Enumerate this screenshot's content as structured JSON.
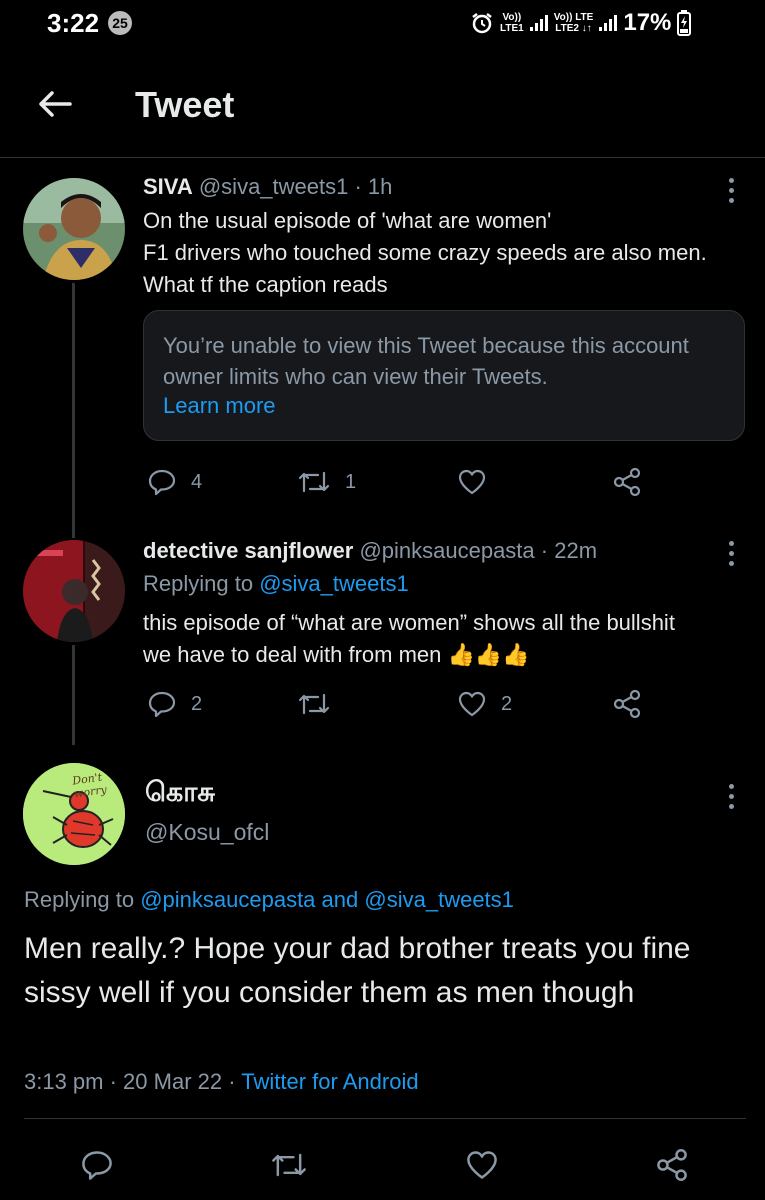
{
  "status_bar": {
    "time": "3:22",
    "notification_count": "25",
    "sim1": {
      "top": "Vo))",
      "bottom": "LTE1"
    },
    "sim2": {
      "top": "Vo)) LTE",
      "bottom": "LTE2 ↓↑"
    },
    "battery": "17%"
  },
  "header": {
    "title": "Tweet"
  },
  "tweet1": {
    "name": "SIVA",
    "handle": "@siva_tweets1",
    "time": "· 1h",
    "text": "On the usual episode of 'what are women'\nF1 drivers who touched some crazy speeds are also men.\nWhat tf the caption reads",
    "quoted_unavailable": "You’re unable to view this Tweet because this account owner limits who can view their Tweets.",
    "quoted_link": "Learn more",
    "replies": "4",
    "retweets": "1",
    "likes": ""
  },
  "tweet2": {
    "name": "detective sanjflower",
    "handle": "@pinksaucepasta",
    "time": "· 22m",
    "replying_prefix": "Replying to",
    "replying_to": "@siva_tweets1",
    "text": "this episode of “what are women” shows all the bullshit\nwe have to deal with from men",
    "emoji": "👍👍👍",
    "replies": "2",
    "retweets": "",
    "likes": "2"
  },
  "main_tweet": {
    "name": "கொசு",
    "handle": "@Kosu_ofcl",
    "avatar_caption": "Don't worry",
    "replying_prefix": "Replying to",
    "replying_to_1": "@pinksaucepasta",
    "replying_and": "and",
    "replying_to_2": "@siva_tweets1",
    "text": "Men really.? Hope your dad brother treats you fine sissy well if you consider them as men though",
    "timestamp": "3:13 pm · 20 Mar 22 ·",
    "source": "Twitter for Android"
  },
  "colors": {
    "accent": "#1d9bf0",
    "muted": "#8b98a5",
    "background": "#000000"
  }
}
